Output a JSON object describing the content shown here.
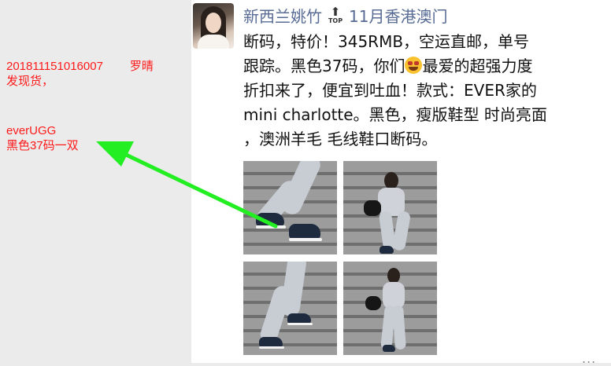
{
  "annotations": {
    "order_number": "201811151016007",
    "customer_name": "罗晴",
    "order_status": "发现货，",
    "brand": "everUGG",
    "item_detail": "黑色37码一双"
  },
  "post": {
    "author": "新西兰姚竹",
    "top_label": "TOP",
    "location": "11月香港澳门",
    "text_before_emoji": "断码，特价！345RMB，空运直邮，单号\n跟踪。黑色37码，你们",
    "emoji": "star-struck-emoji",
    "text_after_emoji": "最爱的超强力度\n折扣来了，便宜到吐血！款式：EVER家的\nmini charlotte。黑色，瘦版鞋型 时尚亮面\n，澳洲羊毛  毛线鞋口断码。",
    "photos": [
      "photo-shoes-closeup",
      "photo-seated-model",
      "photo-legs-on-steps",
      "photo-model-with-bag"
    ],
    "more_indicator": "..."
  },
  "colors": {
    "annotation": "#ff1a1a",
    "arrow": "#22ee22",
    "author_link": "#576b95",
    "left_bg": "#ebebeb"
  }
}
